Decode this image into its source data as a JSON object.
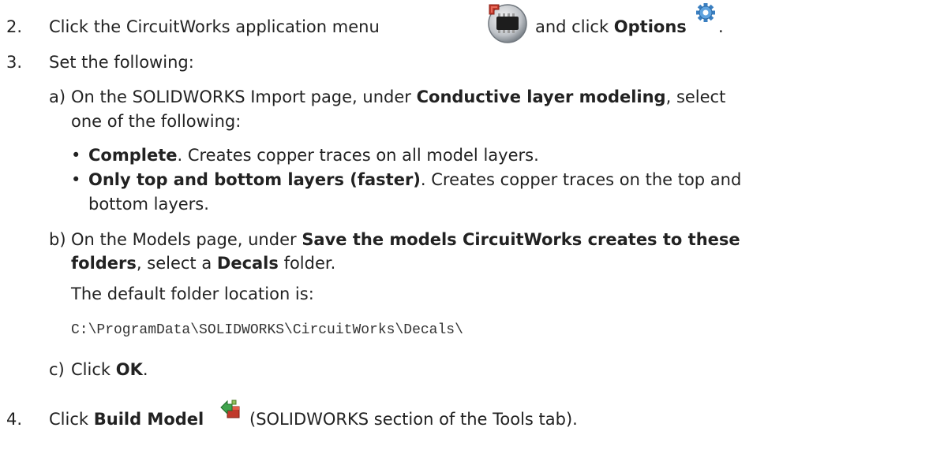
{
  "steps": {
    "s2": {
      "num": "2.",
      "pre": "Click the CircuitWorks application menu",
      "mid": "and click",
      "bold": "Options",
      "end": ".",
      "app_menu_icon": "circuitworks-chip-icon",
      "options_icon": "gear-icon"
    },
    "s3": {
      "num": "3.",
      "text": "Set the following:",
      "a": {
        "label": "a)",
        "pre": "On the SOLIDWORKS Import page, under",
        "bold": "Conductive layer modeling",
        "post": ", select",
        "line2": "one of the following:",
        "bullets": [
          {
            "bold": "Complete",
            "text": ". Creates copper traces on all model layers."
          },
          {
            "bold": "Only top and bottom layers (faster)",
            "text": ". Creates copper traces on the top and",
            "cont": "bottom layers."
          }
        ]
      },
      "b": {
        "label": "b)",
        "pre": "On the Models page, under",
        "bold1": "Save the models CircuitWorks creates to these",
        "bold2": "folders",
        "mid": ", select a",
        "bold3": "Decals",
        "post": " folder.",
        "note": "The default folder location is:",
        "path": "C:\\ProgramData\\SOLIDWORKS\\CircuitWorks\\Decals\\"
      },
      "c": {
        "label": "c)",
        "pre": "Click",
        "bold": "OK",
        "post": "."
      }
    },
    "s4": {
      "num": "4.",
      "pre": "Click",
      "bold": "Build Model",
      "post": "(SOLIDWORKS section of the Tools tab).",
      "icon": "build-model-icon"
    }
  }
}
